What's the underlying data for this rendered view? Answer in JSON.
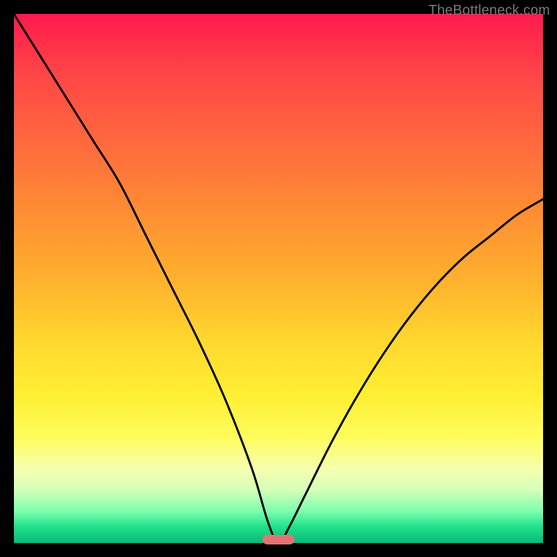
{
  "watermark": "TheBottleneck.com",
  "colors": {
    "top": "#ff1a4d",
    "mid": "#ffd82e",
    "bottom": "#0ab87a",
    "curve": "#000000",
    "marker": "#e57373",
    "frame": "#000000"
  },
  "chart_data": {
    "type": "line",
    "title": "",
    "xlabel": "",
    "ylabel": "",
    "xlim": [
      0,
      100
    ],
    "ylim": [
      0,
      100
    ],
    "annotations": [],
    "series": [
      {
        "name": "bottleneck-curve",
        "x": [
          0,
          5,
          10,
          15,
          20,
          25,
          30,
          35,
          40,
          45,
          48,
          50,
          52,
          55,
          60,
          65,
          70,
          75,
          80,
          85,
          90,
          95,
          100
        ],
        "y": [
          100,
          92,
          84,
          76,
          68,
          58,
          48,
          38,
          27,
          14,
          4,
          0,
          3,
          9,
          19,
          28,
          36,
          43,
          49,
          54,
          58,
          62,
          65
        ]
      }
    ],
    "marker": {
      "x_center": 50,
      "width_pct": 6,
      "y": 0
    },
    "background_gradient": {
      "direction": "vertical",
      "stops": [
        {
          "pct": 0,
          "color": "#ff1a4d"
        },
        {
          "pct": 50,
          "color": "#ffd82e"
        },
        {
          "pct": 100,
          "color": "#0ab87a"
        }
      ]
    }
  }
}
